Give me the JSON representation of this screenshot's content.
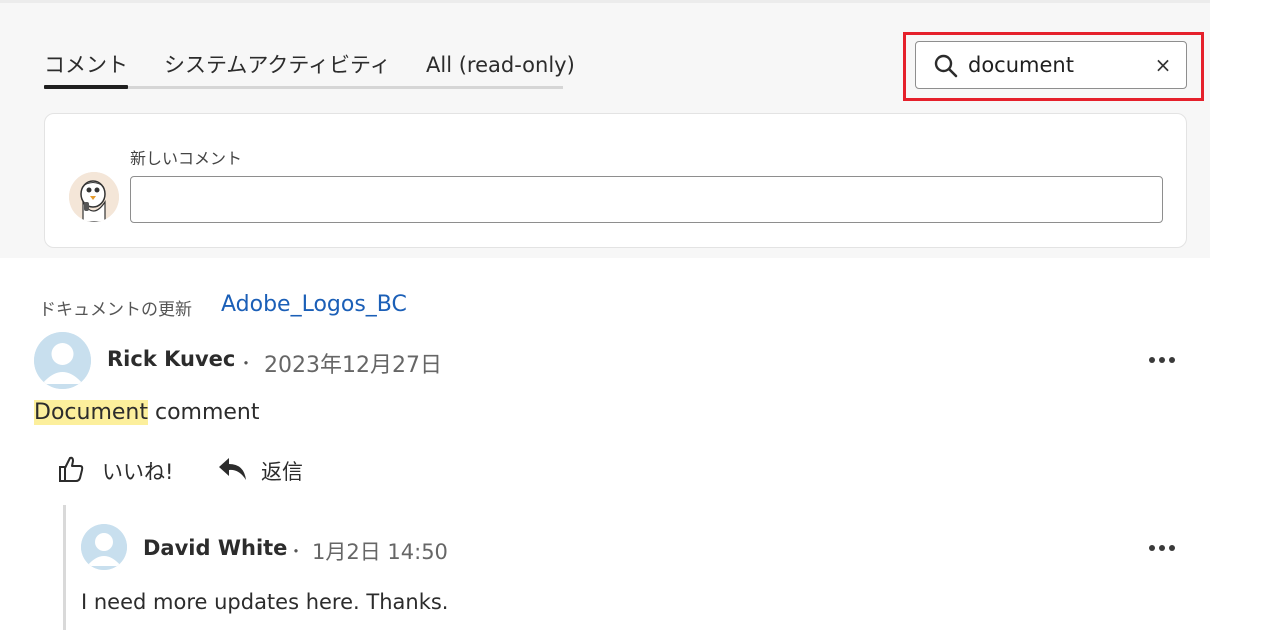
{
  "tabs": [
    {
      "label": "コメント",
      "active": true
    },
    {
      "label": "システムアクティビティ",
      "active": false
    },
    {
      "label": "All (read-only)",
      "active": false
    }
  ],
  "search": {
    "value": "document",
    "clear_label": "×"
  },
  "new_comment": {
    "label": "新しいコメント",
    "placeholder": ""
  },
  "activity": {
    "type_label": "ドキュメントの更新",
    "document_link": "Adobe_Logos_BC",
    "comment": {
      "author": "Rick Kuvec",
      "separator": "・",
      "date": "2023年12月27日",
      "text_highlight": "Document",
      "text_rest": " comment",
      "like_label": "いいね!",
      "reply_label": "返信"
    },
    "reply": {
      "author": "David White",
      "separator": "・",
      "date": "1月2日 14:50",
      "text": "I need more updates here. Thanks."
    }
  },
  "colors": {
    "link": "#1b5fb7",
    "highlight": "#fcef9c",
    "search_outline": "#e5202b",
    "avatar_placeholder": "#c8dfee"
  }
}
